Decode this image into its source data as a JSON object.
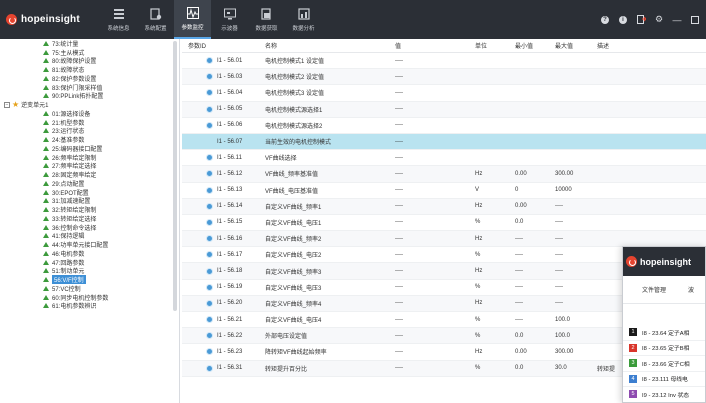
{
  "brand": "hopeinsight",
  "nav": [
    {
      "label": "系统信息",
      "icon": "monitor-icon"
    },
    {
      "label": "系统配置",
      "icon": "config-icon"
    },
    {
      "label": "参数监控",
      "icon": "waveform-monitor-icon"
    },
    {
      "label": "示波器",
      "icon": "oscilloscope-icon"
    },
    {
      "label": "数据获取",
      "icon": "data-fetch-icon"
    },
    {
      "label": "数据分析",
      "icon": "data-analysis-icon"
    }
  ],
  "top_icons": [
    "help-icon",
    "info-icon",
    "export-icon",
    "settings-icon",
    "minimize-icon",
    "maximize-icon"
  ],
  "tree": [
    {
      "label": "73:统计量",
      "type": "child"
    },
    {
      "label": "75:主从模式",
      "type": "child"
    },
    {
      "label": "80:故障保护设置",
      "type": "child"
    },
    {
      "label": "81:故障状态",
      "type": "child"
    },
    {
      "label": "82:保护参数设置",
      "type": "child"
    },
    {
      "label": "83:保护门限采样值",
      "type": "child"
    },
    {
      "label": "90:PPLink拓扑配置",
      "type": "child"
    },
    {
      "label": "逆变单元1",
      "type": "folder"
    },
    {
      "label": "01:源选择设备",
      "type": "child"
    },
    {
      "label": "21:机型参数",
      "type": "child"
    },
    {
      "label": "23:运行状态",
      "type": "child"
    },
    {
      "label": "24:基准参数",
      "type": "child"
    },
    {
      "label": "25:编码器接口配置",
      "type": "child"
    },
    {
      "label": "26:频率给定限制",
      "type": "child"
    },
    {
      "label": "27:频率给定选择",
      "type": "child"
    },
    {
      "label": "28:固定频率给定",
      "type": "child"
    },
    {
      "label": "29:点动配置",
      "type": "child"
    },
    {
      "label": "30:EPOT配置",
      "type": "child"
    },
    {
      "label": "31:加减速配置",
      "type": "child"
    },
    {
      "label": "32:转矩给定限制",
      "type": "child"
    },
    {
      "label": "33:转矩给定选择",
      "type": "child"
    },
    {
      "label": "36:控制命令选择",
      "type": "child"
    },
    {
      "label": "41:保持逻辑",
      "type": "child"
    },
    {
      "label": "44:功率单元接口配置",
      "type": "child"
    },
    {
      "label": "46:电机参数",
      "type": "child"
    },
    {
      "label": "47:回路参数",
      "type": "child"
    },
    {
      "label": "51:制动单元",
      "type": "child"
    },
    {
      "label": "56:V/F控制",
      "type": "child",
      "selected": true
    },
    {
      "label": "57:VC控制",
      "type": "child"
    },
    {
      "label": "60:同步电机控制参数",
      "type": "child"
    },
    {
      "label": "61:电机参数辨识",
      "type": "child"
    }
  ],
  "table": {
    "headers": [
      "参数ID",
      "名称",
      "值",
      "单位",
      "最小值",
      "最大值",
      "描述"
    ],
    "rows": [
      {
        "id": "I1 - 56.01",
        "name": "电机控制模式1 设定值",
        "value": "----",
        "unit": "",
        "min": "",
        "max": "",
        "desc": "",
        "gear": true
      },
      {
        "id": "I1 - 56.03",
        "name": "电机控制模式2 设定值",
        "value": "----",
        "unit": "",
        "min": "",
        "max": "",
        "desc": "",
        "gear": true
      },
      {
        "id": "I1 - 56.04",
        "name": "电机控制模式3 设定值",
        "value": "----",
        "unit": "",
        "min": "",
        "max": "",
        "desc": "",
        "gear": true
      },
      {
        "id": "I1 - 56.05",
        "name": "电机控制模式源选择1",
        "value": "----",
        "unit": "",
        "min": "",
        "max": "",
        "desc": "",
        "gear": true
      },
      {
        "id": "I1 - 56.06",
        "name": "电机控制模式源选择2",
        "value": "----",
        "unit": "",
        "min": "",
        "max": "",
        "desc": "",
        "gear": true
      },
      {
        "id": "I1 - 56.07",
        "name": "当前生效的电机控制模式",
        "value": "----",
        "unit": "",
        "min": "",
        "max": "",
        "desc": "",
        "gear": false,
        "highlight": true
      },
      {
        "id": "I1 - 56.11",
        "name": "VF曲线选择",
        "value": "----",
        "unit": "",
        "min": "",
        "max": "",
        "desc": "",
        "gear": true
      },
      {
        "id": "I1 - 56.12",
        "name": "VF曲线_频率基准值",
        "value": "----",
        "unit": "Hz",
        "min": "0.00",
        "max": "300.00",
        "desc": "",
        "gear": true
      },
      {
        "id": "I1 - 56.13",
        "name": "VF曲线_电压基准值",
        "value": "----",
        "unit": "V",
        "min": "0",
        "max": "10000",
        "desc": "",
        "gear": true
      },
      {
        "id": "I1 - 56.14",
        "name": "自定义VF曲线_频率1",
        "value": "----",
        "unit": "Hz",
        "min": "0.00",
        "max": "----",
        "desc": "",
        "gear": true
      },
      {
        "id": "I1 - 56.15",
        "name": "自定义VF曲线_电压1",
        "value": "----",
        "unit": "%",
        "min": "0.0",
        "max": "----",
        "desc": "",
        "gear": true
      },
      {
        "id": "I1 - 56.16",
        "name": "自定义VF曲线_频率2",
        "value": "----",
        "unit": "Hz",
        "min": "----",
        "max": "----",
        "desc": "",
        "gear": true
      },
      {
        "id": "I1 - 56.17",
        "name": "自定义VF曲线_电压2",
        "value": "----",
        "unit": "%",
        "min": "----",
        "max": "----",
        "desc": "",
        "gear": true
      },
      {
        "id": "I1 - 56.18",
        "name": "自定义VF曲线_频率3",
        "value": "----",
        "unit": "Hz",
        "min": "----",
        "max": "----",
        "desc": "",
        "gear": true
      },
      {
        "id": "I1 - 56.19",
        "name": "自定义VF曲线_电压3",
        "value": "----",
        "unit": "%",
        "min": "----",
        "max": "----",
        "desc": "",
        "gear": true
      },
      {
        "id": "I1 - 56.20",
        "name": "自定义VF曲线_频率4",
        "value": "----",
        "unit": "Hz",
        "min": "----",
        "max": "----",
        "desc": "",
        "gear": true
      },
      {
        "id": "I1 - 56.21",
        "name": "自定义VF曲线_电压4",
        "value": "----",
        "unit": "%",
        "min": "----",
        "max": "100.0",
        "desc": "",
        "gear": true
      },
      {
        "id": "I1 - 56.22",
        "name": "外部电压设定值",
        "value": "----",
        "unit": "%",
        "min": "0.0",
        "max": "100.0",
        "desc": "",
        "gear": true
      },
      {
        "id": "I1 - 56.23",
        "name": "降转矩VF曲线起始频率",
        "value": "----",
        "unit": "Hz",
        "min": "0.00",
        "max": "300.00",
        "desc": "",
        "gear": true
      },
      {
        "id": "I1 - 56.31",
        "name": "转矩提升百分比",
        "value": "----",
        "unit": "%",
        "min": "0.0",
        "max": "30.0",
        "desc": "转矩提",
        "gear": true
      }
    ]
  },
  "overlay": {
    "brand": "hopeinsight",
    "tabs": [
      "文件管理",
      "波"
    ],
    "rows": [
      {
        "num": "1",
        "color": "#1a1a1a",
        "text": "I8 - 23.64 定子A相"
      },
      {
        "num": "2",
        "color": "#d9352b",
        "text": "I8 - 23.65 定子B相"
      },
      {
        "num": "3",
        "color": "#3a9b3a",
        "text": "I8 - 23.66 定子C相"
      },
      {
        "num": "4",
        "color": "#3d7fd0",
        "text": "I8 - 23.111 母线电"
      },
      {
        "num": "5",
        "color": "#8e4bb0",
        "text": "I9 - 23.12 Inv 状态"
      }
    ]
  },
  "colors": {
    "topbar": "#2b2f36",
    "accent": "#5aa7e8",
    "highlight_row": "#b9e3f0",
    "brand_red": "#e5442f",
    "tree_icon": "#3c9a3c"
  }
}
